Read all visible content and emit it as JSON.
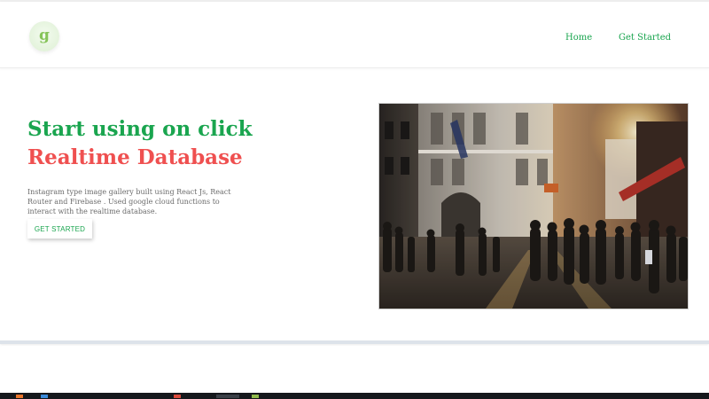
{
  "navbar": {
    "logo_letter": "g",
    "links": [
      {
        "label": "Home"
      },
      {
        "label": "Get Started"
      }
    ]
  },
  "hero": {
    "title_line1": "Start using on click",
    "title_line2": "Realtime Database",
    "description": "Instagram type image gallery built using React Js, React Router and Firebase . Used google cloud functions to interact with the realtime database.",
    "cta_label": "GET STARTED",
    "image_icon": "city-street-photo"
  },
  "colors": {
    "accent_green": "#1aa54f",
    "accent_red": "#ef5050",
    "logo_bg": "#e4f3dc"
  }
}
